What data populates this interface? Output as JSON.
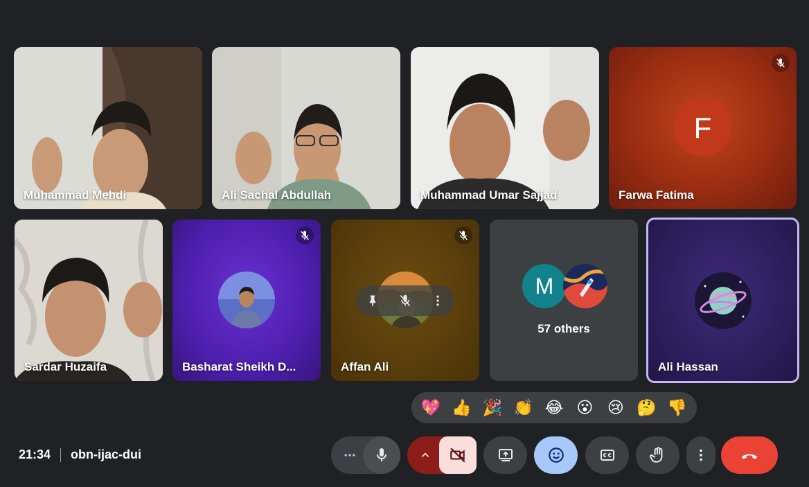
{
  "participants_row1": [
    {
      "name": "Muhammad Mehdi"
    },
    {
      "name": "Ali Sachal Abdullah"
    },
    {
      "name": "Muhammad Umar Sajjad"
    },
    {
      "name": "Farwa Fatima",
      "initial": "F",
      "muted": true
    }
  ],
  "participants_row2": [
    {
      "name": "Sardar Huzaifa"
    },
    {
      "name": "Basharat Sheikh D...",
      "muted": true
    },
    {
      "name": "Affan Ali",
      "muted": true
    },
    {
      "others_initial": "M",
      "others_label": "57 others"
    },
    {
      "name": "Ali Hassan",
      "active_speaker": true
    }
  ],
  "reactions": [
    "💖",
    "👍",
    "🎉",
    "👏",
    "😂",
    "😮",
    "😢",
    "🤔",
    "👎"
  ],
  "meeting": {
    "time": "21:34",
    "code": "obn-ijac-dui"
  },
  "controls": {
    "more_options_icon": "horizontal-dots-icon",
    "mic_icon": "mic-icon",
    "camera_state": "off",
    "present_icon": "present-screen-icon",
    "emoji_icon": "emoji-icon",
    "captions_icon": "captions-icon",
    "raise_hand_icon": "raise-hand-icon",
    "more_icon": "vertical-dots-icon",
    "leave_icon": "phone-hangup-icon"
  },
  "colors": {
    "background": "#202124",
    "end_call": "#ea4335",
    "emoji_active": "#a8c7fa",
    "camera_off_bg": "#f9dedc",
    "camera_chevron_bg": "#8c1d18",
    "active_speaker_border": "#c5b8f5"
  }
}
